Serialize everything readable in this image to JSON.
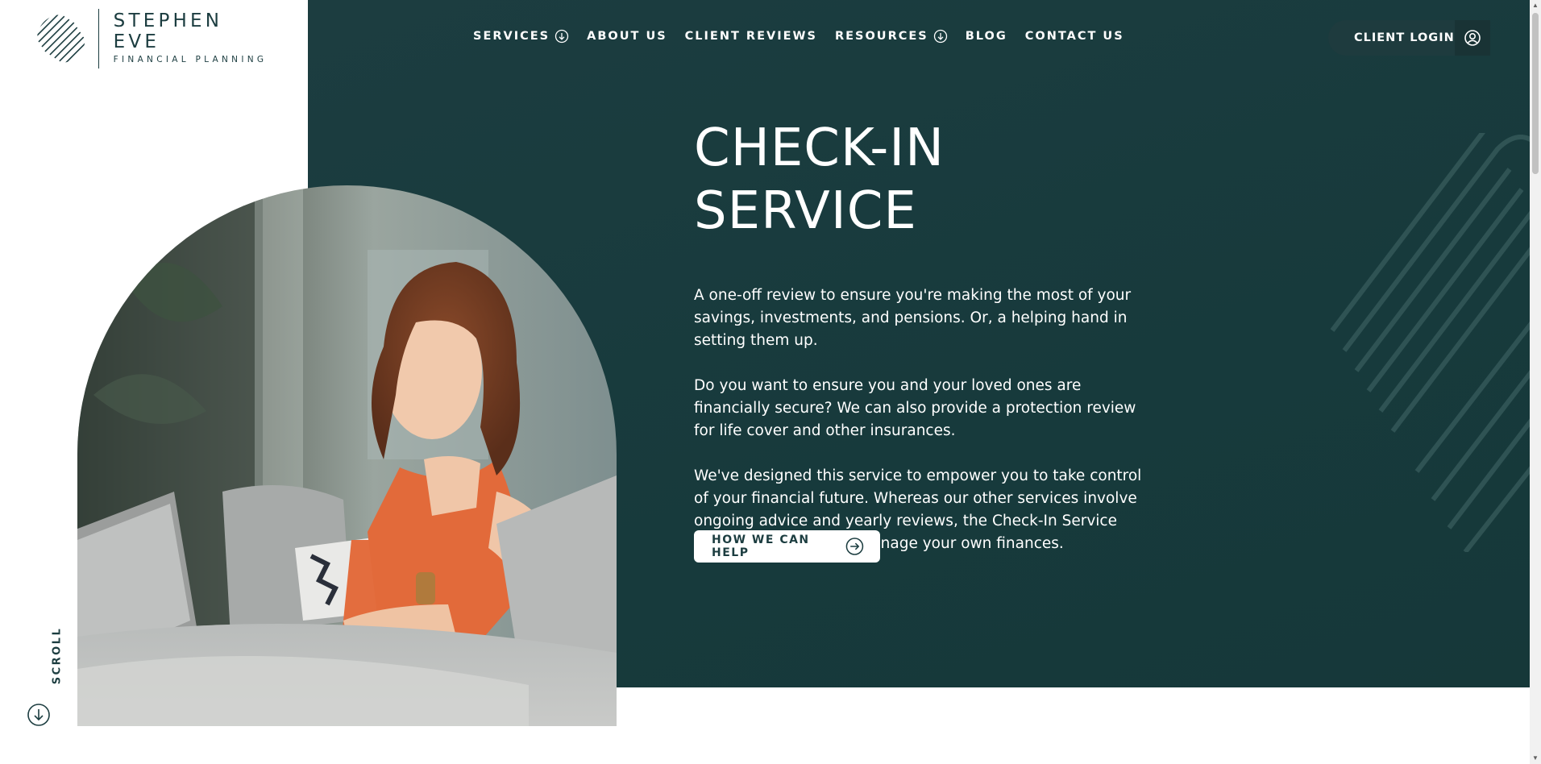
{
  "brand": {
    "name": "STEPHEN EVE",
    "tagline": "FINANCIAL PLANNING",
    "colors": {
      "primary": "#1c3d40",
      "surface": "#ffffff",
      "accent_photo": "#e26a3a"
    }
  },
  "nav": {
    "items": [
      {
        "label": "SERVICES",
        "has_dropdown": true
      },
      {
        "label": "ABOUT US",
        "has_dropdown": false
      },
      {
        "label": "CLIENT REVIEWS",
        "has_dropdown": false
      },
      {
        "label": "RESOURCES",
        "has_dropdown": true
      },
      {
        "label": "BLOG",
        "has_dropdown": false
      },
      {
        "label": "CONTACT US",
        "has_dropdown": false
      }
    ],
    "login_label": "CLIENT LOGIN",
    "login_icon": "user-circle-icon"
  },
  "hero": {
    "title": "CHECK-IN SERVICE",
    "paragraphs": [
      "A one-off review to ensure you're making the most of your savings, investments, and pensions. Or, a helping hand in setting them up.",
      "Do you want to ensure you and your loved ones are financially secure? We can also provide a protection review for life cover and other insurances.",
      "We've designed this service to empower you to take control of your financial future. Whereas our other services involve ongoing advice and yearly reviews, the Check-In Service aims to set you up to manage your own finances."
    ],
    "cta_label": "HOW WE CAN HELP",
    "cta_icon": "arrow-right-circle-icon",
    "photo_icon": "woman-laptop-photo"
  },
  "scroll": {
    "label": "SCROLL",
    "icon": "arrow-down-circle-icon"
  }
}
